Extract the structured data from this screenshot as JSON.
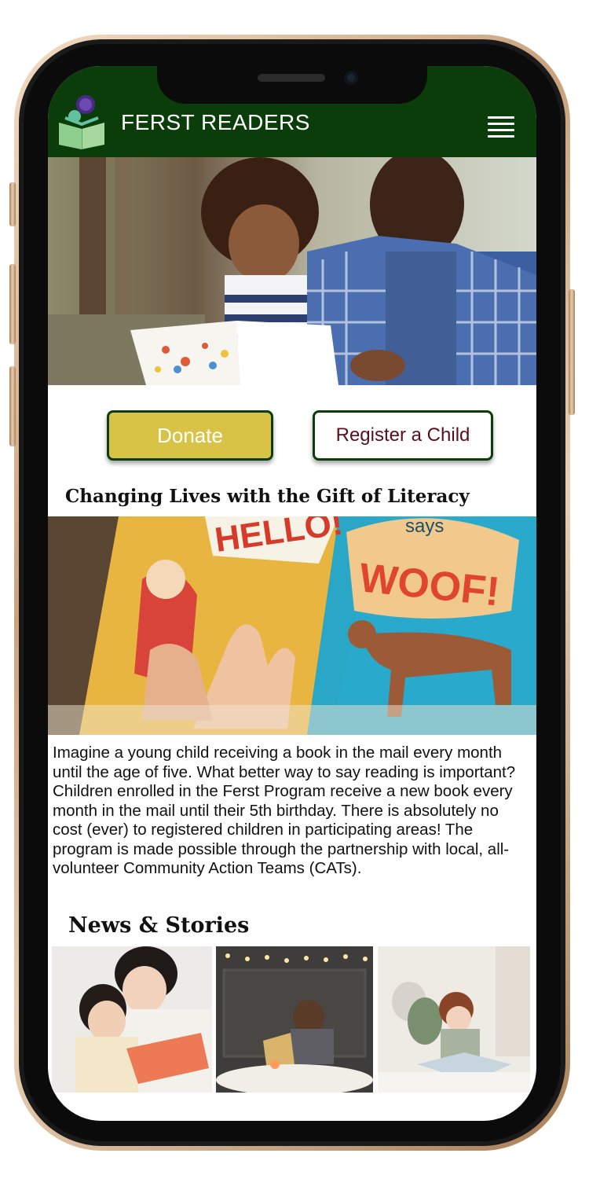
{
  "header": {
    "brand": "FERST READERS",
    "logo_icon": "reader-book-logo-icon",
    "menu_icon": "hamburger-menu-icon",
    "color": "#0b3d0b"
  },
  "hero": {
    "image": "father-daughter-reading-photo"
  },
  "actions": {
    "donate_label": "Donate",
    "register_label": "Register a Child",
    "donate_color": "#d9c347",
    "register_text_color": "#5a0f1d"
  },
  "intro": {
    "title": "Changing Lives with the Gift of Literacy",
    "image": "child-hands-on-picture-book-photo",
    "book_text_left": "HELLO!",
    "book_text_right": "WOOF!",
    "book_caption": "says",
    "body": "Imagine a young child receiving a book in the mail every month until the age of five. What better way to say reading is important? Children enrolled in the Ferst Program receive a new book every month in the mail until their 5th birthday. There is absolutely no cost (ever) to registered children in participating areas! The program is made possible through the partnership with local, all-volunteer Community Action Teams (CATs)."
  },
  "news": {
    "title": "News & Stories",
    "items": [
      {
        "image": "mother-baby-reading-photo"
      },
      {
        "image": "boy-reading-under-lights-photo"
      },
      {
        "image": "toddler-reading-with-plush-toys-photo"
      }
    ]
  }
}
